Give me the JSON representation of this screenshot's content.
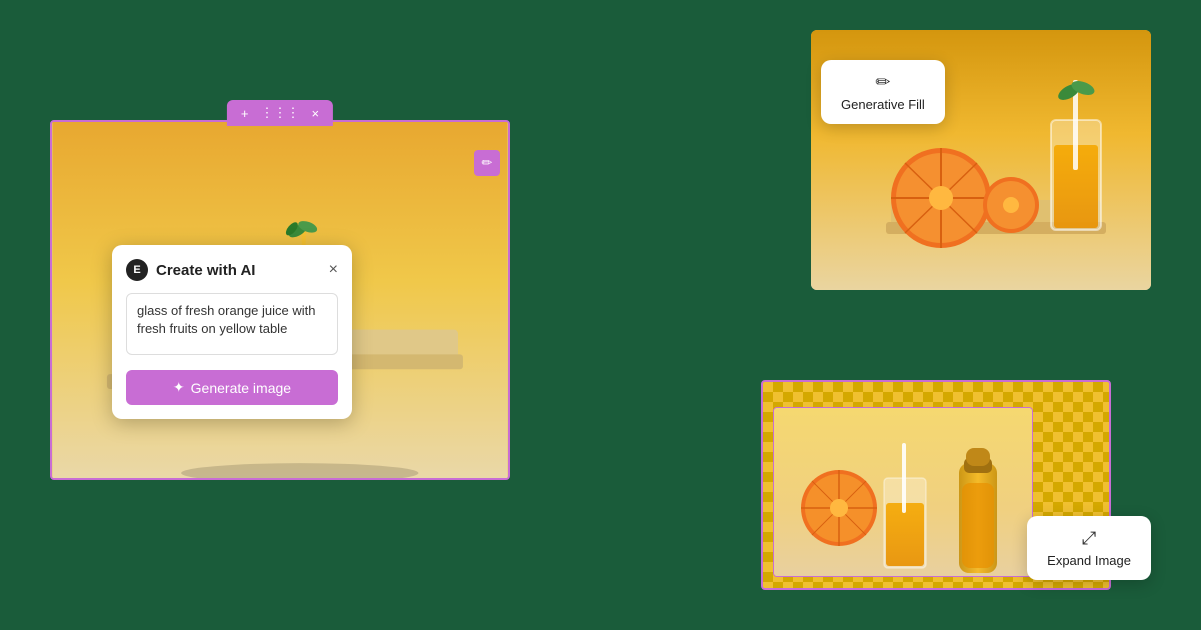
{
  "background_color": "#1a5c3a",
  "left_panel": {
    "toolbar": {
      "plus": "+",
      "grid": "⋮⋮⋮",
      "close": "×"
    },
    "edit_icon": "✏",
    "ai_dialog": {
      "title": "Create with AI",
      "elementor_icon": "E",
      "close_btn": "×",
      "textarea_value": "glass of fresh orange juice with fresh fruits on yellow table",
      "generate_btn_icon": "✦",
      "generate_btn_label": "Generate image"
    }
  },
  "top_right": {
    "card_icon": "✏",
    "card_label": "Generative Fill"
  },
  "bottom_right": {
    "card_icon": "⤢",
    "card_label": "Expand Image"
  }
}
